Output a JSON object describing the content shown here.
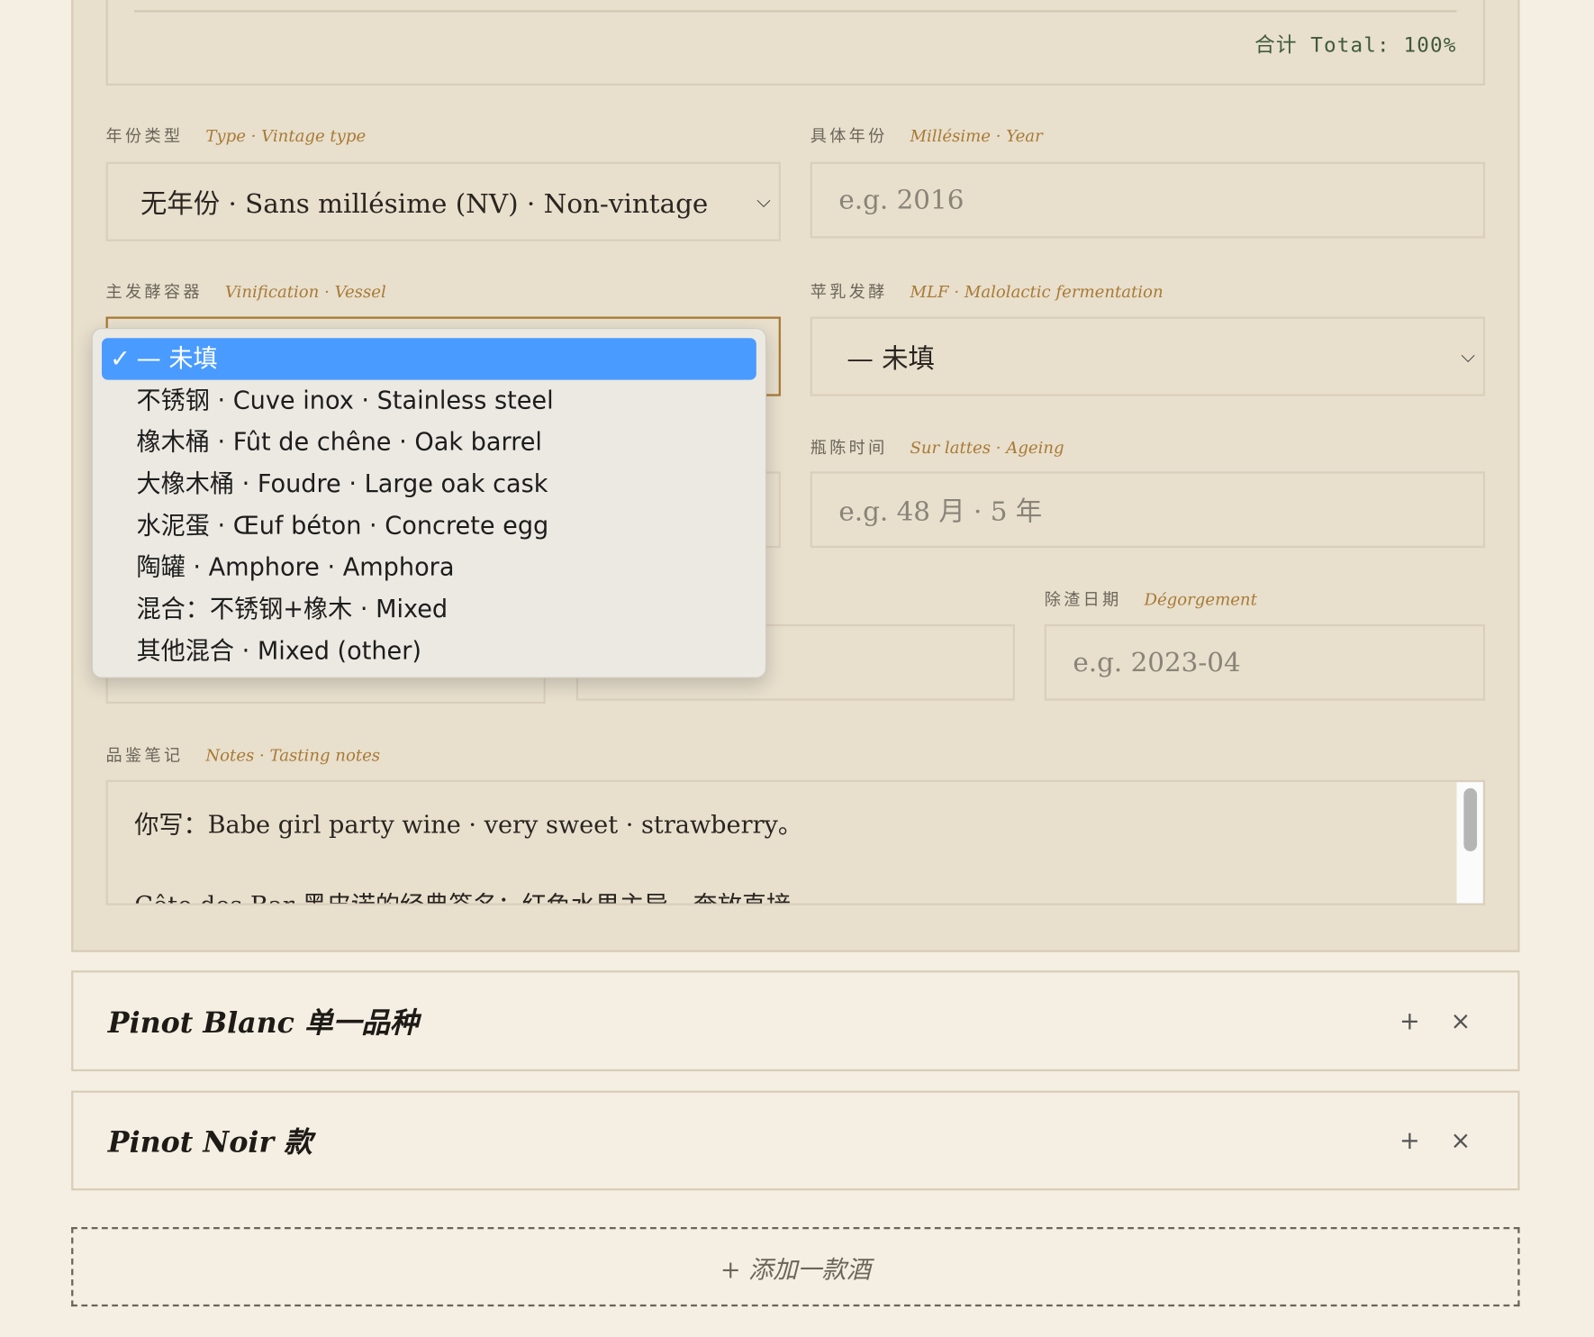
{
  "blend_total": "合计 Total: 100%",
  "fields": {
    "vintage_type": {
      "label_cn": "年份类型",
      "label_en": "Type · Vintage type",
      "value": "无年份 · Sans millésime (NV) · Non-vintage"
    },
    "year": {
      "label_cn": "具体年份",
      "label_en": "Millésime · Year",
      "placeholder": "e.g. 2016"
    },
    "vessel": {
      "label_cn": "主发酵容器",
      "label_en": "Vinification · Vessel"
    },
    "mlf": {
      "label_cn": "苹乳发酵",
      "label_en": "MLF · Malolactic fermentation",
      "value": "— 未填"
    },
    "ageing": {
      "label_cn": "瓶陈时间",
      "label_en": "Sur lattes · Ageing",
      "placeholder": "e.g. 48 月 · 5 年"
    },
    "disgorgement": {
      "label_cn": "除渣日期",
      "label_en": "Dégorgement",
      "placeholder": "e.g. 2023-04"
    },
    "notes": {
      "label_cn": "品鉴笔记",
      "label_en": "Notes · Tasting notes",
      "line1": "你写：Babe girl party wine · very sweet · strawberry。",
      "line2": "Côte des Bar 黑皮诺的经典签名：红色水果主导，奔放直接"
    }
  },
  "vessel_dropdown": {
    "options": [
      "— 未填",
      "不锈钢 · Cuve inox · Stainless steel",
      "橡木桶 · Fût de chêne · Oak barrel",
      "大橡木桶 · Foudre · Large oak cask",
      "水泥蛋 · Œuf béton · Concrete egg",
      "陶罐 · Amphore · Amphora",
      "混合：不锈钢+橡木 · Mixed",
      "其他混合 · Mixed (other)"
    ],
    "selected_index": 0
  },
  "wines": [
    {
      "title": "Pinot Blanc 单一品种"
    },
    {
      "title": "Pinot Noir 款"
    }
  ],
  "add_wine_label": "+ 添加一款酒",
  "icons": {
    "check": "✓",
    "chevron": "⌵",
    "plus": "+",
    "close": "×"
  }
}
